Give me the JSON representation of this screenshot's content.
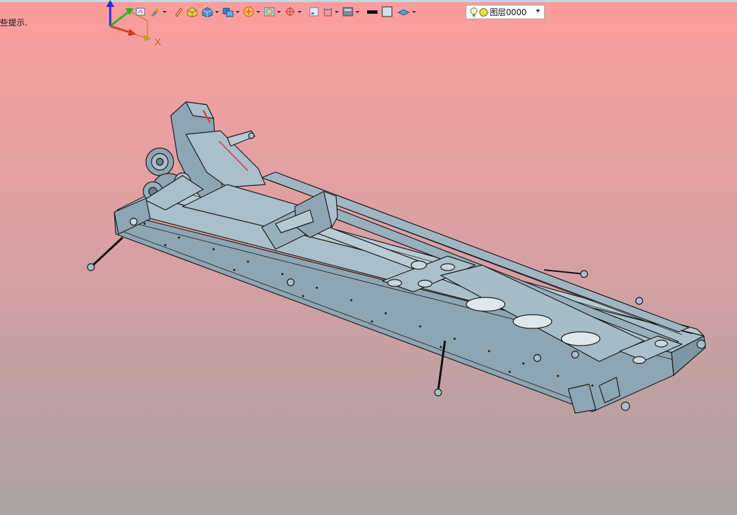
{
  "status": {
    "hint_text": "些提示."
  },
  "axes": {
    "x_label": "X"
  },
  "toolbar": {
    "icons": [
      "view-home-icon",
      "paint-brush-icon",
      "pencil-icon",
      "shaded-box-icon",
      "solid-box-icon",
      "multi-body-icon",
      "section-circle-icon",
      "fit-view-icon",
      "target-point-icon",
      "window-icon",
      "dimension-icon",
      "display-mode-icon",
      "line-color-icon",
      "fill-color-icon",
      "layer-display-icon"
    ],
    "layer": {
      "name": "图层0000"
    }
  },
  "colors": {
    "bg_top": "#ff9b9b",
    "bg_bottom": "#aca2a3",
    "model": "#a9bfcb",
    "model_dark": "#8ea5b3",
    "edge": "#1a1a1a"
  }
}
